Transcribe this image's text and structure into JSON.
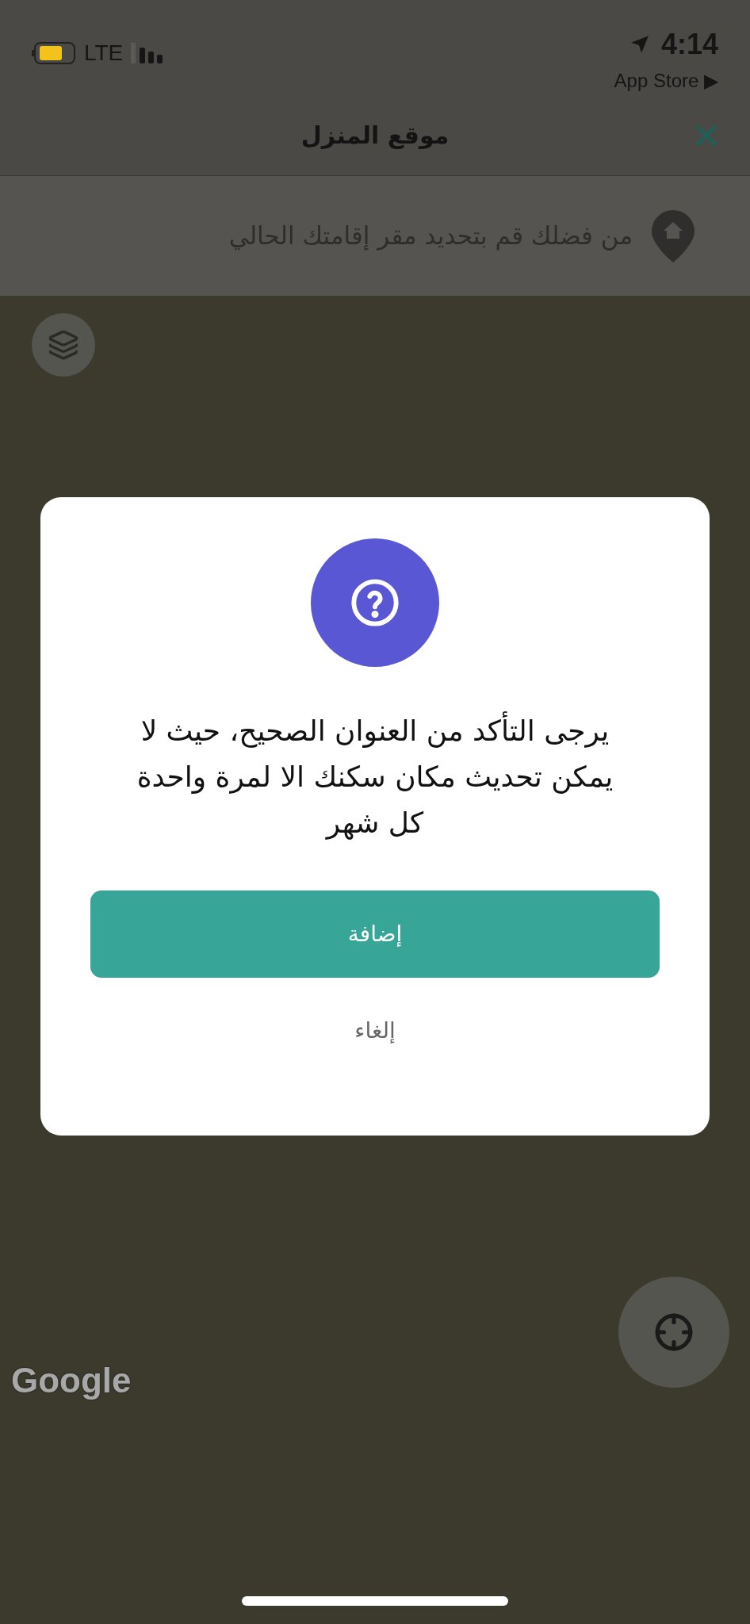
{
  "status_bar": {
    "carrier": "LTE",
    "time": "4:14",
    "back_link": "App Store ▶"
  },
  "header": {
    "title": "موقع المنزل"
  },
  "location_prompt": {
    "text": "من فضلك قم بتحديد مقر إقامتك الحالي"
  },
  "map": {
    "attribution": "Google"
  },
  "dialog": {
    "message": "يرجى التأكد من العنوان الصحيح، حيث لا يمكن تحديث مكان سكنك الا لمرة واحدة كل شهر",
    "buttons": [
      {
        "label": "إضافة",
        "kind": "primary"
      },
      {
        "label": "إلغاء",
        "kind": "text"
      }
    ]
  }
}
